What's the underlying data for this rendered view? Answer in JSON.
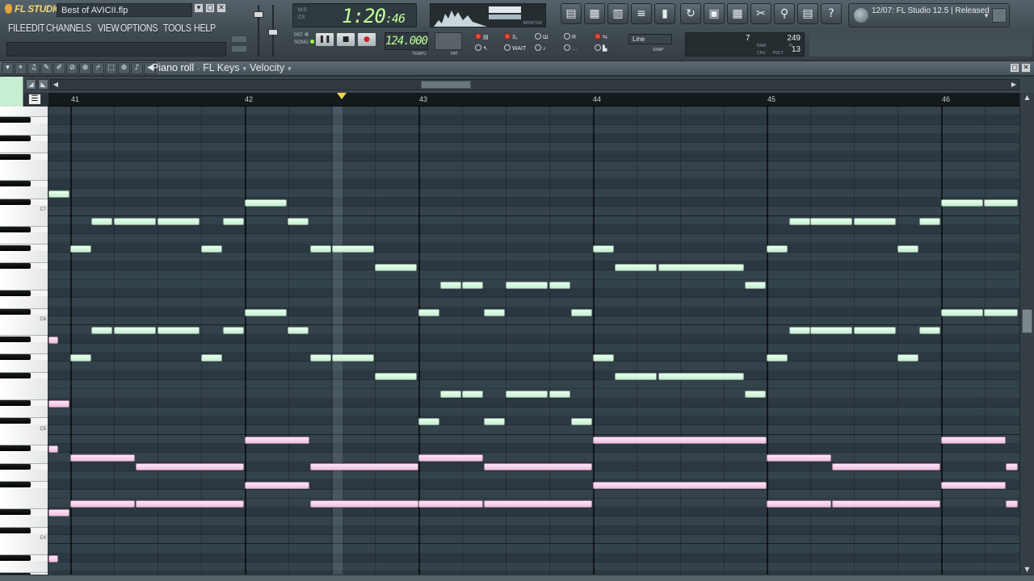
{
  "app": {
    "logo": "FL STUDIO",
    "filename": "Best of AVICII.flp",
    "menu": [
      "FILE",
      "EDIT",
      "CHANNELS",
      "VIEW",
      "OPTIONS",
      "TOOLS",
      "HELP"
    ]
  },
  "transport": {
    "time_main": "1:20",
    "time_sub": ":46",
    "mini_labels": [
      "M:S",
      "CS"
    ],
    "mode_labels": [
      "PAT",
      "SONG"
    ],
    "tempo": "124.000",
    "tempo_label": "TEMPO",
    "pat_label": "PAT",
    "scope_label": "MONITOR",
    "buttons": {
      "pause": "❚❚",
      "stop": "■",
      "record": "●"
    }
  },
  "options": {
    "snap_value": "Line",
    "snap_label": "SNAP",
    "labels": [
      "3₂",
      "WAIT",
      "R"
    ]
  },
  "cpu": {
    "voices": "7",
    "ram": "249",
    "poly": "13",
    "labels": [
      "RAM",
      "FL",
      "CPU",
      "POLY"
    ]
  },
  "news": {
    "text": "12/07: FL Studio 12.5 | Released"
  },
  "piano_roll": {
    "title": "Piano roll",
    "target": "FL Keys",
    "param": "Velocity",
    "bars": [
      "41",
      "42",
      "43",
      "44",
      "45",
      "46"
    ],
    "key_labels": [
      "C7",
      "C6",
      "C5",
      "C4"
    ]
  },
  "colors": {
    "note_green": "#c4f0d2",
    "note_pink": "#f4bde0",
    "grid_bg": "#34424b",
    "lcd_green": "#c5ff9a"
  },
  "icons": {
    "tool_buttons": [
      "playlist-icon",
      "step-sequencer-icon",
      "piano-roll-icon",
      "browser-icon",
      "mixer-icon"
    ],
    "util_buttons": [
      "undo-icon",
      "save-icon",
      "export-icon",
      "tools-icon",
      "search-icon",
      "notes-icon",
      "help-icon"
    ]
  }
}
